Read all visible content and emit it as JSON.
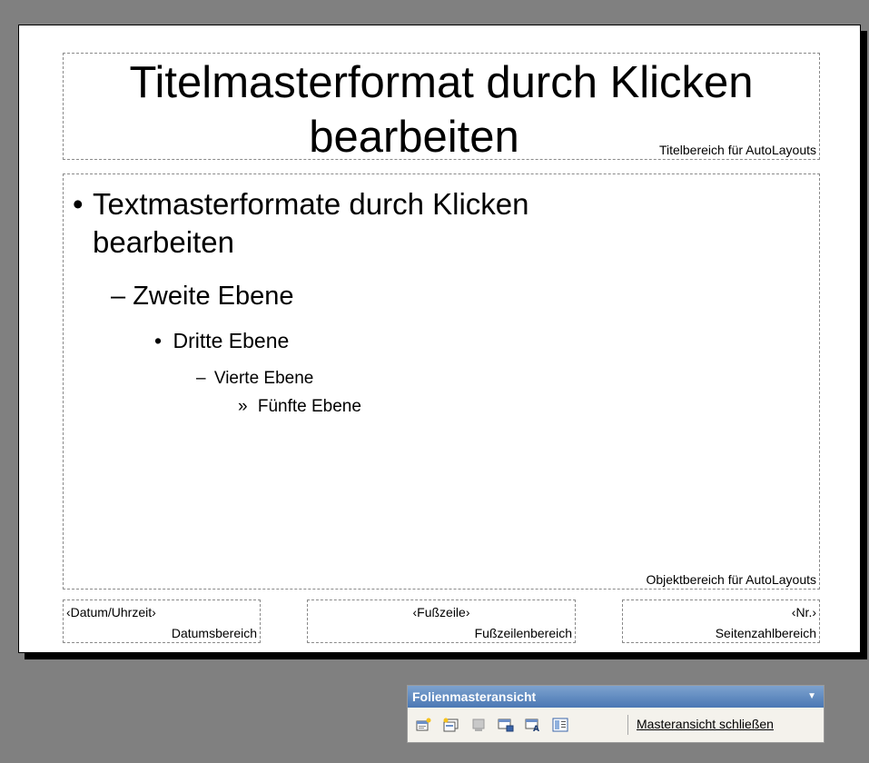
{
  "title_placeholder": {
    "line1": "Titelmasterformat durch Klicken",
    "line2": "bearbeiten",
    "area_label": "Titelbereich für AutoLayouts"
  },
  "body_placeholder": {
    "level1_line1": "Textmasterformate durch Klicken",
    "level1_line2": "bearbeiten",
    "level2": "Zweite Ebene",
    "level3": "Dritte Ebene",
    "level4": "Vierte Ebene",
    "level5": "Fünfte Ebene",
    "area_label": "Objektbereich für AutoLayouts"
  },
  "bullets": {
    "l1": "•",
    "l2": "–",
    "l3": "•",
    "l4": "–",
    "l5": "»"
  },
  "footer": {
    "date_field": "‹Datum/Uhrzeit›",
    "date_area": "Datumsbereich",
    "footer_field": "‹Fußzeile›",
    "footer_area": "Fußzeilenbereich",
    "number_field": "‹Nr.›",
    "number_area": "Seitenzahlbereich"
  },
  "toolbar": {
    "title": "Folienmasteransicht",
    "close_label": "Masteransicht schließen",
    "icons": [
      "insert-new-slide-master-icon",
      "insert-new-title-master-icon",
      "delete-master-icon",
      "preserve-master-icon",
      "rename-master-icon",
      "master-layout-icon"
    ]
  },
  "colors": {
    "background": "#808080",
    "slide": "#ffffff",
    "toolbar_title_bar": "#4a78b4"
  }
}
